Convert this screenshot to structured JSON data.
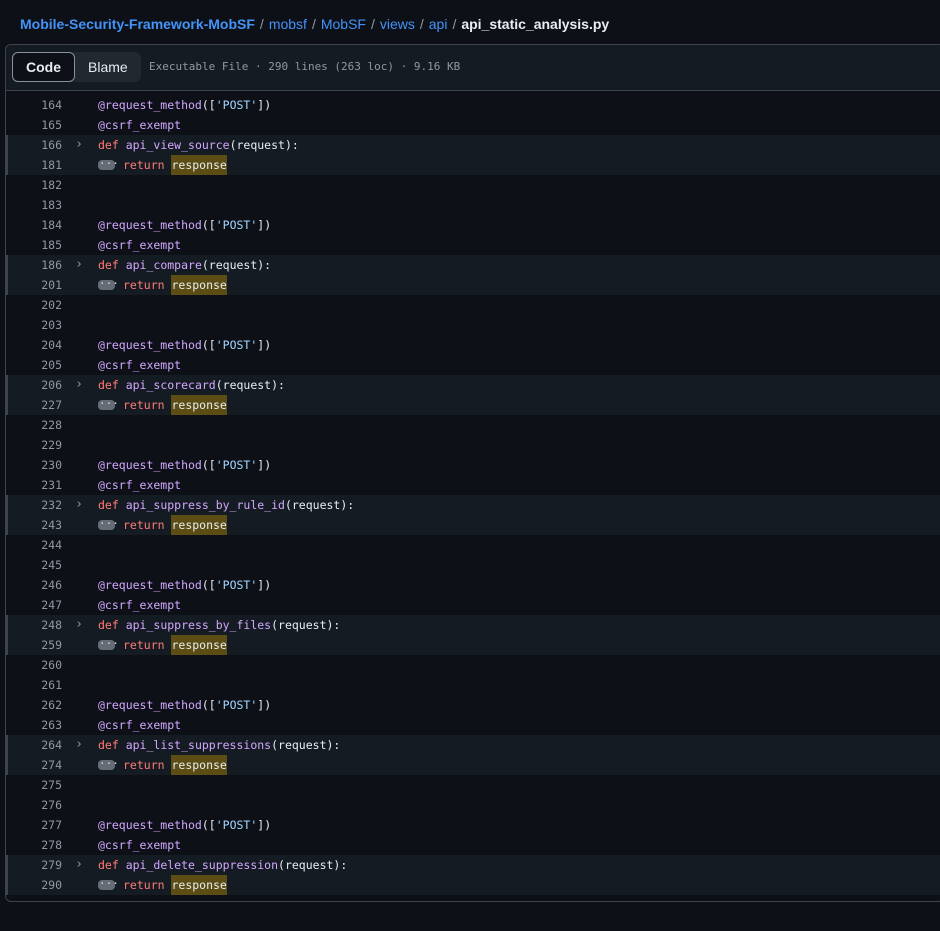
{
  "breadcrumb": {
    "repo": "Mobile-Security-Framework-MobSF",
    "segments": [
      "mobsf",
      "MobSF",
      "views",
      "api"
    ],
    "file": "api_static_analysis.py",
    "separator": "/"
  },
  "toolbar": {
    "code_label": "Code",
    "blame_label": "Blame",
    "file_info": "Executable File · 290 lines (263 loc) · 9.16 KB"
  },
  "code_lines": [
    {
      "n": "164",
      "type": "decorator_post"
    },
    {
      "n": "165",
      "type": "decorator_csrf"
    },
    {
      "n": "166",
      "type": "def",
      "fn": "api_view_source"
    },
    {
      "n": "181",
      "type": "return"
    },
    {
      "n": "182",
      "type": "blank"
    },
    {
      "n": "183",
      "type": "blank"
    },
    {
      "n": "184",
      "type": "decorator_post"
    },
    {
      "n": "185",
      "type": "decorator_csrf"
    },
    {
      "n": "186",
      "type": "def",
      "fn": "api_compare"
    },
    {
      "n": "201",
      "type": "return"
    },
    {
      "n": "202",
      "type": "blank"
    },
    {
      "n": "203",
      "type": "blank"
    },
    {
      "n": "204",
      "type": "decorator_post"
    },
    {
      "n": "205",
      "type": "decorator_csrf"
    },
    {
      "n": "206",
      "type": "def",
      "fn": "api_scorecard"
    },
    {
      "n": "227",
      "type": "return"
    },
    {
      "n": "228",
      "type": "blank"
    },
    {
      "n": "229",
      "type": "blank"
    },
    {
      "n": "230",
      "type": "decorator_post"
    },
    {
      "n": "231",
      "type": "decorator_csrf"
    },
    {
      "n": "232",
      "type": "def",
      "fn": "api_suppress_by_rule_id"
    },
    {
      "n": "243",
      "type": "return"
    },
    {
      "n": "244",
      "type": "blank"
    },
    {
      "n": "245",
      "type": "blank"
    },
    {
      "n": "246",
      "type": "decorator_post"
    },
    {
      "n": "247",
      "type": "decorator_csrf"
    },
    {
      "n": "248",
      "type": "def",
      "fn": "api_suppress_by_files"
    },
    {
      "n": "259",
      "type": "return"
    },
    {
      "n": "260",
      "type": "blank"
    },
    {
      "n": "261",
      "type": "blank"
    },
    {
      "n": "262",
      "type": "decorator_post"
    },
    {
      "n": "263",
      "type": "decorator_csrf"
    },
    {
      "n": "264",
      "type": "def",
      "fn": "api_list_suppressions"
    },
    {
      "n": "274",
      "type": "return"
    },
    {
      "n": "275",
      "type": "blank"
    },
    {
      "n": "276",
      "type": "blank"
    },
    {
      "n": "277",
      "type": "decorator_post"
    },
    {
      "n": "278",
      "type": "decorator_csrf"
    },
    {
      "n": "279",
      "type": "def",
      "fn": "api_delete_suppression"
    },
    {
      "n": "290",
      "type": "return"
    }
  ],
  "tokens": {
    "decorator": "@request_method",
    "open": "([",
    "method": "'POST'",
    "close": "])",
    "csrf": "@csrf_exempt",
    "def_kw": "def",
    "params": "(request):",
    "return_kw": "return",
    "return_val": "response"
  },
  "colors": {
    "background": "#0d1117",
    "link": "#4493f8",
    "keyword": "#ff7b72",
    "function": "#d2a8ff",
    "string": "#a5d6ff",
    "highlight": "#5c4d14"
  },
  "icons": {
    "fold": "chevron-right-icon",
    "collapsed": "ellipsis-icon"
  }
}
